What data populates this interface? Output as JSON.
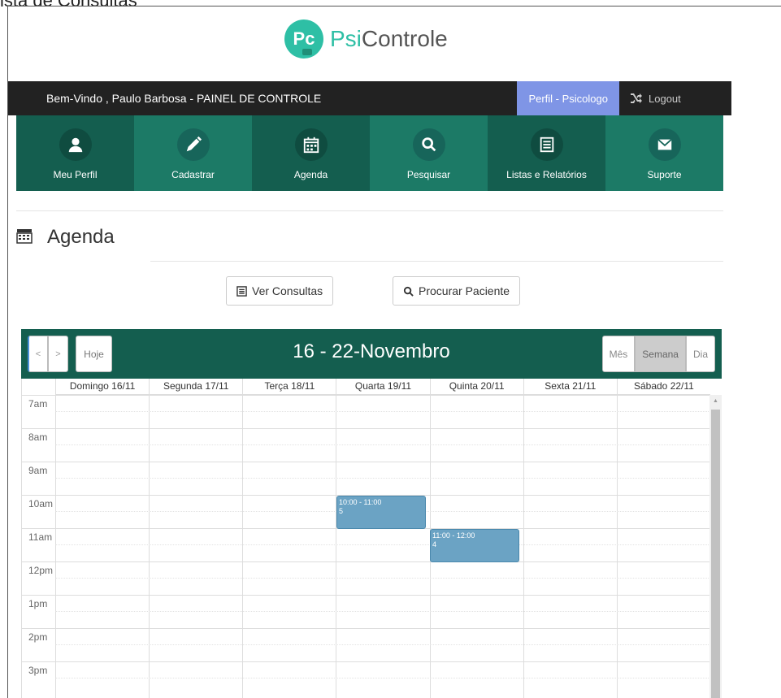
{
  "window_title": "ista de Consultas",
  "brand": {
    "logo_text": "Pc",
    "name_light": "Psi",
    "name_bold": "Controle"
  },
  "topbar": {
    "welcome": "Bem-Vindo , Paulo  Barbosa - PAINEL DE CONTROLE",
    "perfil": "Perfil - Psicologo",
    "logout": "Logout"
  },
  "nav": [
    {
      "label": "Meu Perfil",
      "icon": "user-icon"
    },
    {
      "label": "Cadastrar",
      "icon": "pencil-icon"
    },
    {
      "label": "Agenda",
      "icon": "calendar-icon"
    },
    {
      "label": "Pesquisar",
      "icon": "search-icon"
    },
    {
      "label": "Listas e Relatórios",
      "icon": "list-icon"
    },
    {
      "label": "Suporte",
      "icon": "envelope-icon"
    }
  ],
  "page": {
    "title": "Agenda"
  },
  "buttons": {
    "ver_consultas": "Ver Consultas",
    "procurar_paciente": "Procurar Paciente"
  },
  "calendar": {
    "title": "16 - 22-Novembro",
    "prev": "<",
    "next": ">",
    "today": "Hoje",
    "views": {
      "mes": "Mês",
      "semana": "Semana",
      "dia": "Dia"
    },
    "active_view": "Semana",
    "days": [
      "Domingo 16/11",
      "Segunda 17/11",
      "Terça 18/11",
      "Quarta 19/11",
      "Quinta 20/11",
      "Sexta 21/11",
      "Sábado 22/11"
    ],
    "hours": [
      "7am",
      "8am",
      "9am",
      "10am",
      "11am",
      "12pm",
      "1pm",
      "2pm",
      "3pm"
    ],
    "events": [
      {
        "time": "10:00 - 11:00",
        "title": "5",
        "day": "Quarta 19/11"
      },
      {
        "time": "11:00 - 12:00",
        "title": "4",
        "day": "Quinta 20/11"
      }
    ],
    "event_color": "#6ba3c4"
  },
  "colors": {
    "header_dark": "#222222",
    "teal_dark": "#145e4f",
    "teal_light": "#1c7a66",
    "perfil_blue": "#7f95e6",
    "brand_teal": "#2ebfa5"
  }
}
